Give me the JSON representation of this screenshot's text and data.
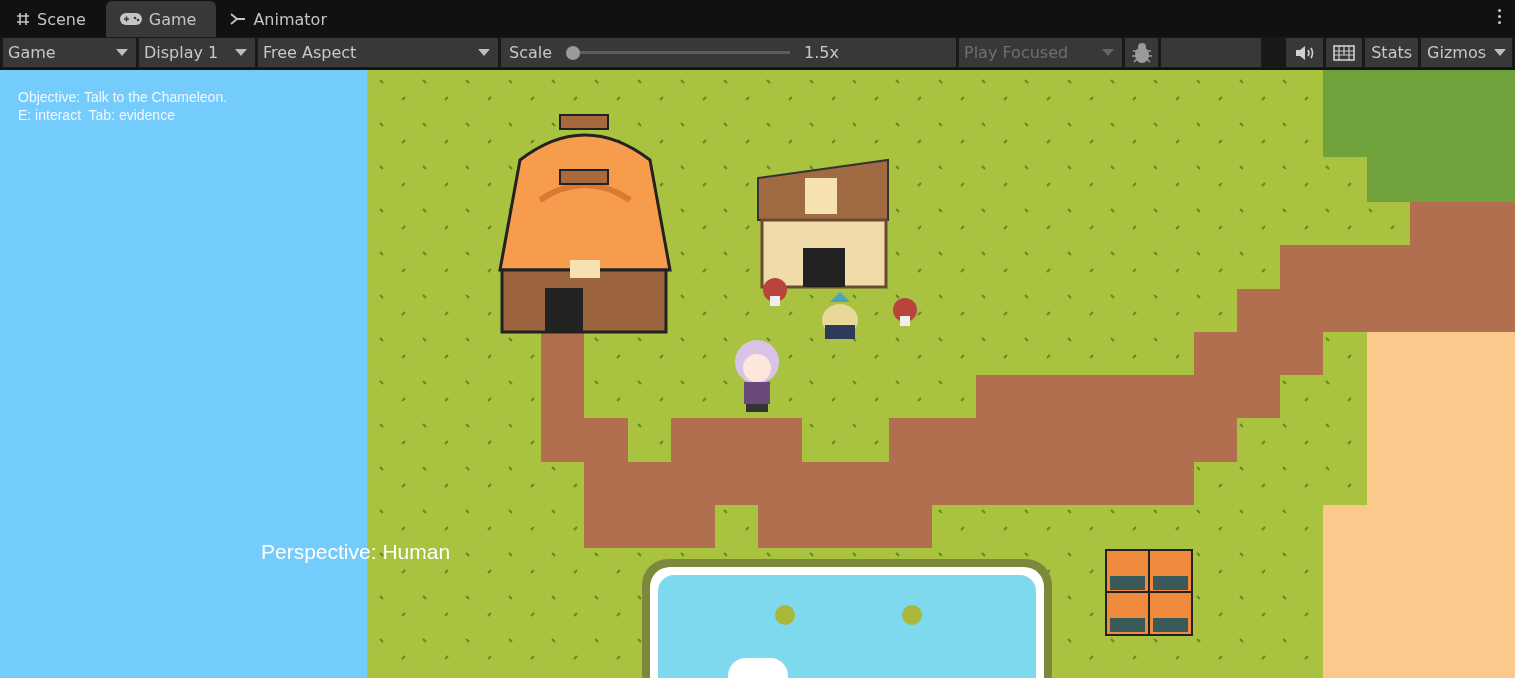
{
  "tabs": [
    {
      "label": "Scene",
      "selected": false
    },
    {
      "label": "Game",
      "selected": true
    },
    {
      "label": "Animator",
      "selected": false
    }
  ],
  "toolbar": {
    "view_dropdown": "Game",
    "display_dropdown": "Display 1",
    "aspect_dropdown": "Free Aspect",
    "scale": {
      "label": "Scale",
      "level": 0.03,
      "reading": "1.5x"
    },
    "play_mode": {
      "label": "Play Focused",
      "disabled": true
    },
    "stats_button": "Stats",
    "gizmos_button": "Gizmos"
  },
  "game": {
    "hud_lines": [
      "Objective: Talk to the Chameleon.",
      "E: interact  Tab: evidence"
    ],
    "perspective": "Perspective: Human"
  }
}
